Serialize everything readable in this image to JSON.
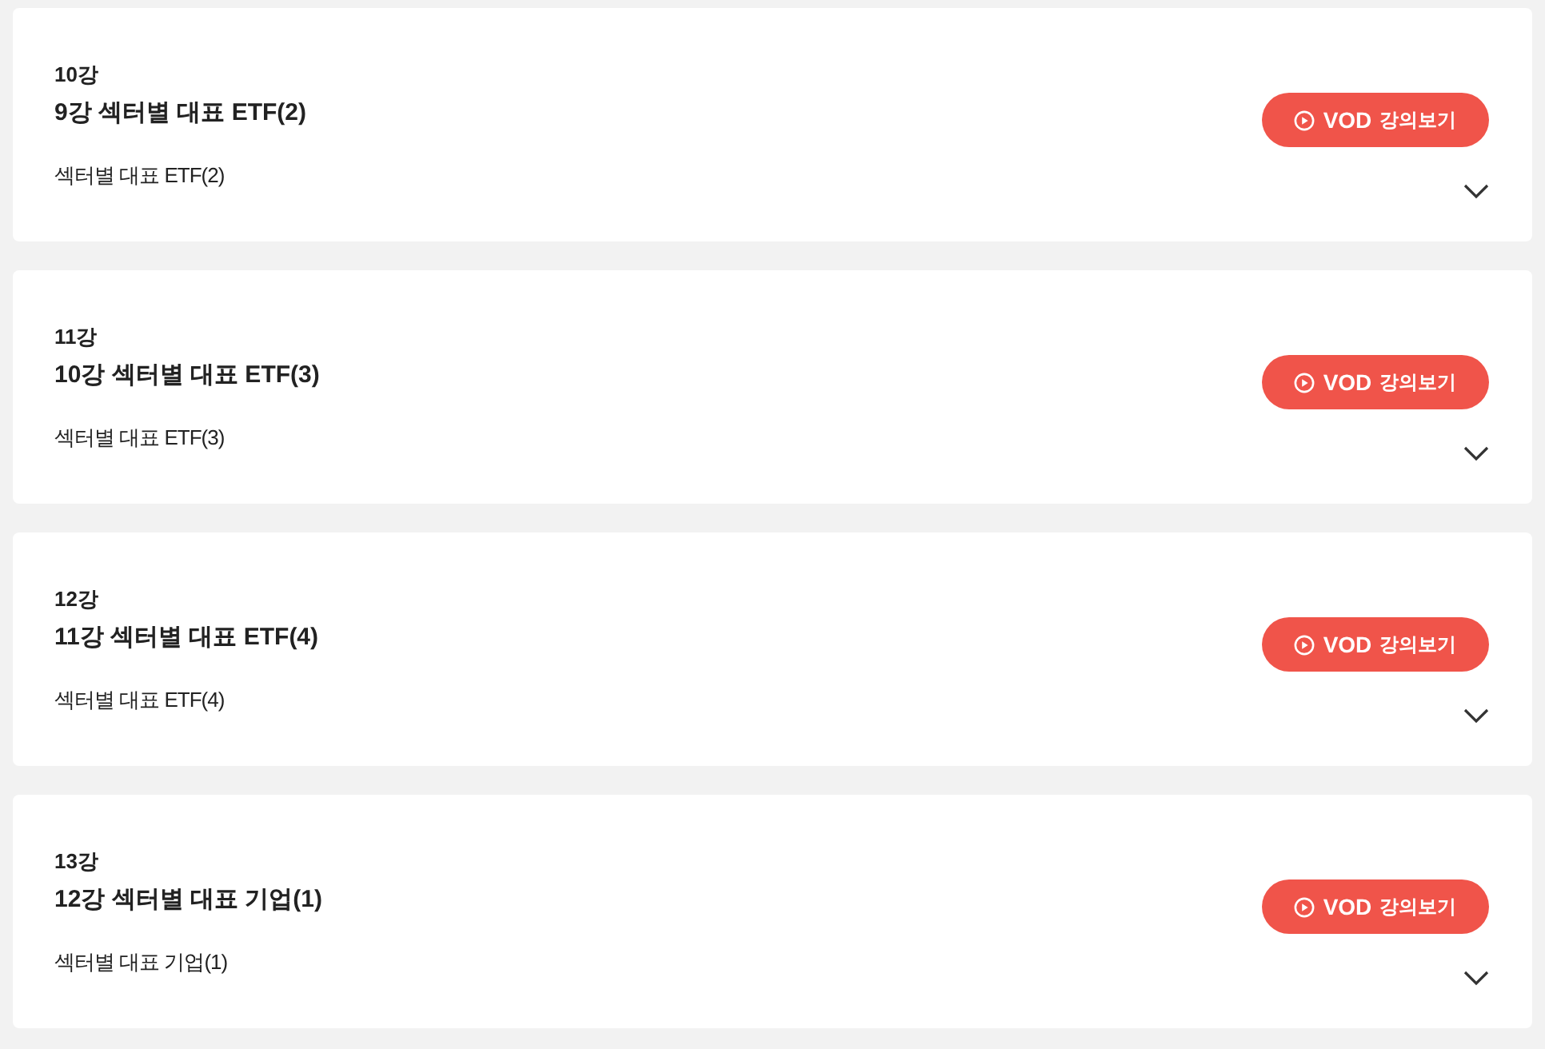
{
  "lectures": [
    {
      "number": "10강",
      "title": "9강 섹터별 대표 ETF(2)",
      "description": "섹터별 대표 ETF(2)",
      "button": {
        "main": "VOD",
        "sub": "강의보기"
      }
    },
    {
      "number": "11강",
      "title": "10강 섹터별 대표 ETF(3)",
      "description": "섹터별 대표 ETF(3)",
      "button": {
        "main": "VOD",
        "sub": "강의보기"
      }
    },
    {
      "number": "12강",
      "title": "11강 섹터별 대표 ETF(4)",
      "description": "섹터별 대표 ETF(4)",
      "button": {
        "main": "VOD",
        "sub": "강의보기"
      }
    },
    {
      "number": "13강",
      "title": "12강 섹터별 대표 기업(1)",
      "description": "섹터별 대표 기업(1)",
      "button": {
        "main": "VOD",
        "sub": "강의보기"
      }
    }
  ]
}
